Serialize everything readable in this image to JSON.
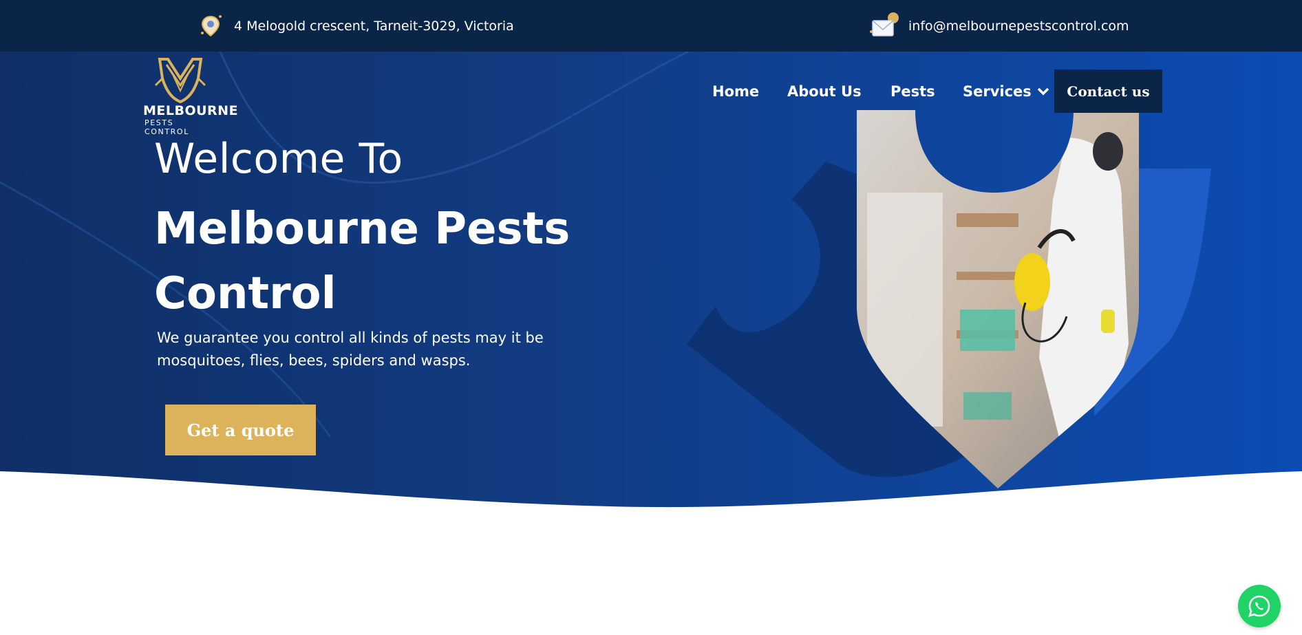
{
  "topbar": {
    "address": "4 Melogold crescent, Tarneit-3029, Victoria",
    "address_icon": "map-pin-icon",
    "email": "info@melbournepestscontrol.com",
    "email_icon": "envelope-icon"
  },
  "logo": {
    "line1": "MELBOURNE",
    "line2": "PESTS CONTROL"
  },
  "nav": {
    "home": "Home",
    "about": "About  Us",
    "pests": "Pests",
    "services": "Services",
    "services_icon": "chevron-down-icon",
    "contact": "Contact us"
  },
  "hero": {
    "welcome": "Welcome To",
    "headline": "Melbourne Pests Control",
    "subtext": "We guarantee you control all kinds of pests may it be mosquitoes, flies, bees, spiders and wasps.",
    "cta": "Get a quote"
  },
  "floating": {
    "whatsapp_icon": "whatsapp-icon"
  },
  "colors": {
    "topbar": "#0b2548",
    "hero_start": "#0f2f66",
    "hero_end": "#0b4cb3",
    "gold": "#dcb35b",
    "whatsapp": "#1fd366"
  }
}
